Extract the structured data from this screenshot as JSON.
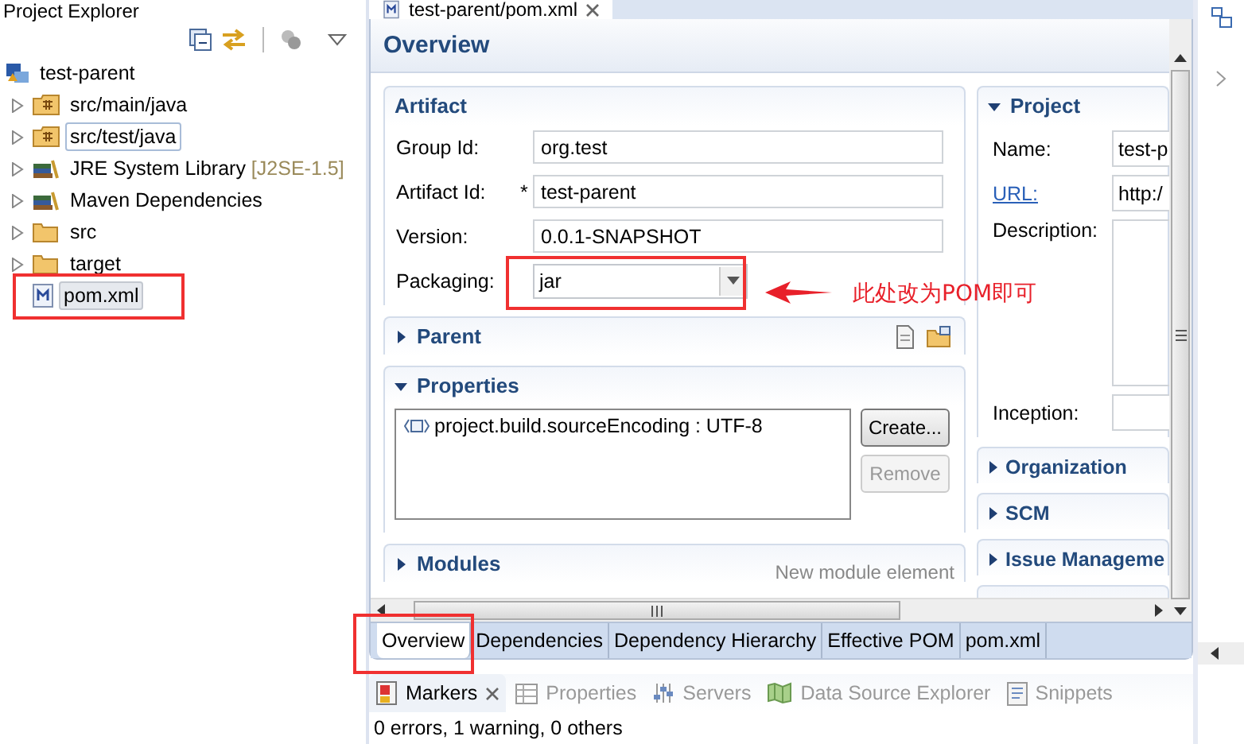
{
  "explorer": {
    "title": "Project Explorer",
    "tree": [
      {
        "label": "test-parent",
        "kind": "project",
        "selected": false,
        "focused": false,
        "children": [
          {
            "label": "src/main/java",
            "kind": "source-folder",
            "selected": false,
            "focused": false
          },
          {
            "label": "src/test/java",
            "kind": "source-folder",
            "selected": false,
            "focused": true
          },
          {
            "label": "JRE System Library",
            "decoration": "[J2SE-1.5]",
            "kind": "library",
            "selected": false,
            "focused": false
          },
          {
            "label": "Maven Dependencies",
            "kind": "library",
            "selected": false,
            "focused": false
          },
          {
            "label": "src",
            "kind": "folder",
            "selected": false,
            "focused": false
          },
          {
            "label": "target",
            "kind": "folder",
            "selected": false,
            "focused": false
          },
          {
            "label": "pom.xml",
            "kind": "file",
            "selected": true,
            "focused": false
          }
        ]
      }
    ]
  },
  "editor": {
    "tab": {
      "title": "test-parent/pom.xml"
    },
    "page_title": "Overview",
    "artifact": {
      "title": "Artifact",
      "fields": [
        {
          "label": "Group Id:",
          "value": "org.test"
        },
        {
          "label": "Artifact Id:",
          "marker": "*",
          "value": "test-parent"
        },
        {
          "label": "Version:",
          "value": "0.0.1-SNAPSHOT"
        }
      ],
      "packaging": {
        "label": "Packaging:",
        "value": "jar"
      }
    },
    "left_sections": [
      {
        "kind": "parent",
        "title": "Parent",
        "expanded": false
      },
      {
        "kind": "properties",
        "title": "Properties",
        "expanded": true,
        "items": [
          "project.build.sourceEncoding : UTF-8"
        ],
        "buttons": [
          {
            "label": "Create...",
            "disabled": false
          },
          {
            "label": "Remove",
            "disabled": true
          }
        ]
      },
      {
        "kind": "modules",
        "title": "Modules",
        "expanded": false,
        "hint": "New module element"
      }
    ],
    "project": {
      "title": "Project",
      "expanded": true,
      "fields": [
        {
          "kind": "text",
          "label": "Name:",
          "value": "test-p"
        },
        {
          "kind": "link",
          "label": "URL:",
          "value": "http:/"
        },
        {
          "kind": "area",
          "label": "Description:"
        },
        {
          "kind": "text",
          "label": "Inception:"
        }
      ]
    },
    "right_sections": [
      {
        "title": "Organization",
        "expanded": false
      },
      {
        "title": "SCM",
        "expanded": false
      },
      {
        "title": "Issue Manageme",
        "expanded": false
      }
    ],
    "page_tabs": [
      {
        "label": "Overview",
        "selected": true
      },
      {
        "label": "Dependencies",
        "selected": false
      },
      {
        "label": "Dependency Hierarchy",
        "selected": false
      },
      {
        "label": "Effective POM",
        "selected": false
      },
      {
        "label": "pom.xml",
        "selected": false
      }
    ]
  },
  "views": [
    {
      "label": "Markers",
      "kind": "markers",
      "selected": true
    },
    {
      "label": "Properties",
      "kind": "properties",
      "selected": false
    },
    {
      "label": "Servers",
      "kind": "servers",
      "selected": false
    },
    {
      "label": "Data Source Explorer",
      "kind": "datasource",
      "selected": false
    },
    {
      "label": "Snippets",
      "kind": "snippets",
      "selected": false
    }
  ],
  "status": "0 errors, 1 warning, 0 others",
  "annotation": {
    "note": "此处改为POM即可"
  }
}
